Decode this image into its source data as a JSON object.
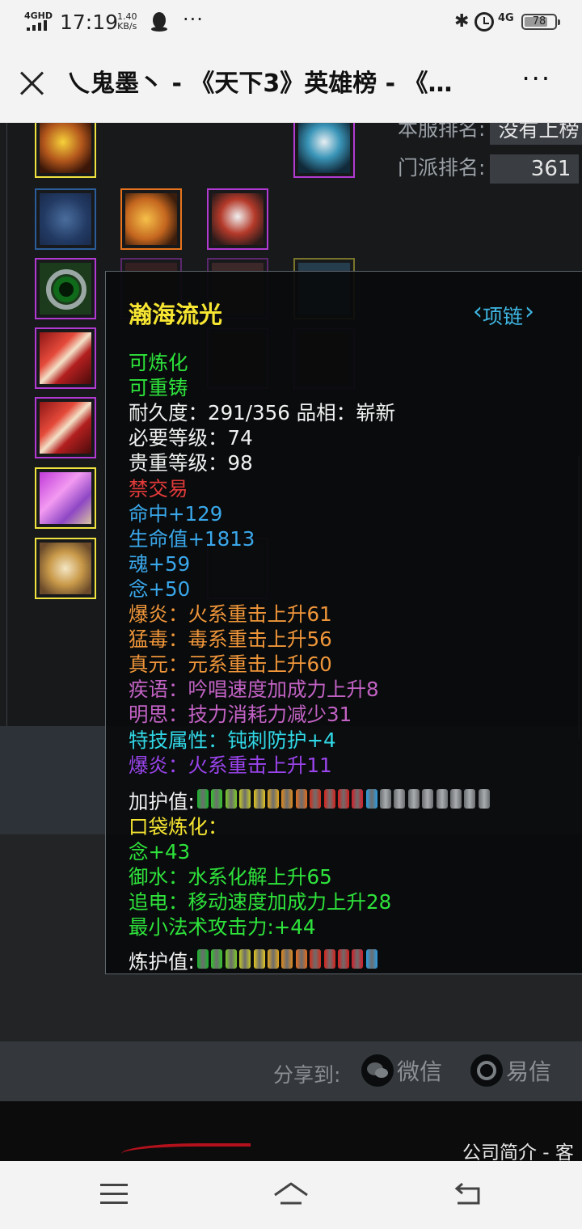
{
  "status_bar": {
    "network": "4GHD",
    "time": "17:19",
    "speed_value": "1.40",
    "speed_unit": "KB/s",
    "more": "···",
    "network_right": "4G",
    "battery_level": "78"
  },
  "browser": {
    "title": "乀鬼墨丶 - 《天下3》英雄榜 - 《…",
    "more": "···"
  },
  "ranking": {
    "server_rank_label": "本服排名:",
    "server_rank_value": "没有上榜",
    "sect_rank_label": "门派排名:",
    "sect_rank_value": "361"
  },
  "tooltip": {
    "item_name": "瀚海流光",
    "slot": "项链",
    "lines": [
      {
        "text": "可炼化",
        "color": "green"
      },
      {
        "text": "可重铸",
        "color": "green"
      },
      {
        "text": "耐久度：291/356   品相：崭新",
        "color": "white"
      },
      {
        "text": "必要等级：74",
        "color": "white"
      },
      {
        "text": "贵重等级：98",
        "color": "white"
      },
      {
        "text": "禁交易",
        "color": "red"
      },
      {
        "text": "命中+129",
        "color": "blue"
      },
      {
        "text": "生命值+1813",
        "color": "blue"
      },
      {
        "text": "魂+59",
        "color": "blue"
      },
      {
        "text": "念+50",
        "color": "blue"
      },
      {
        "text": "爆炎：火系重击上升61",
        "color": "orange"
      },
      {
        "text": "猛毒：毒系重击上升56",
        "color": "orange"
      },
      {
        "text": "真元：元系重击上升60",
        "color": "orange"
      },
      {
        "text": "疾语：吟唱速度加成力上升8",
        "color": "purple"
      },
      {
        "text": "明思：技力消耗力减少31",
        "color": "purple"
      },
      {
        "text": "特技属性：钝刺防护+4",
        "color": "cyan"
      },
      {
        "text": "爆炎：火系重击上升11",
        "color": "violet"
      }
    ],
    "protect_label": "加护值:",
    "protect_filled": 13,
    "protect_total": 21,
    "pocket_title": "口袋炼化：",
    "pocket_lines": [
      {
        "text": "念+43",
        "color": "green"
      },
      {
        "text": "御水：水系化解上升65",
        "color": "green"
      },
      {
        "text": "追电：移动速度加成力上升28",
        "color": "green"
      },
      {
        "text": "最小法术攻击力:+44",
        "color": "green"
      }
    ],
    "refine_label": "炼护值:",
    "refine_filled": 13,
    "refine_total": 13
  },
  "share": {
    "label": "分享到:",
    "wechat": "微信",
    "yixin": "易信"
  },
  "footer": {
    "link": "公司简介 - 客"
  },
  "colors": {
    "green": "#2ee33b",
    "white": "#f1f1f1",
    "red": "#e23a3a",
    "blue": "#3aa7ea",
    "orange": "#f0963a",
    "purple": "#c262c4",
    "cyan": "#31d8e6",
    "violet": "#9a44ec",
    "title_yellow": "#f6e531"
  },
  "equipment_icons": [
    {
      "name": "flame-token-icon",
      "border": "y"
    },
    {
      "name": "silver-blade-icon",
      "border": "p"
    },
    {
      "name": "blue-swirl-icon",
      "border": "b"
    },
    {
      "name": "golden-wings-icon",
      "border": "o"
    },
    {
      "name": "white-tiger-armor-icon",
      "border": "p"
    },
    {
      "name": "green-ring-icon",
      "border": "p"
    },
    {
      "name": "red-sash-icon",
      "border": "p"
    },
    {
      "name": "red-sash-icon",
      "border": "p"
    },
    {
      "name": "pink-fan-icon",
      "border": "y"
    },
    {
      "name": "golden-disc-icon",
      "border": "y"
    }
  ]
}
